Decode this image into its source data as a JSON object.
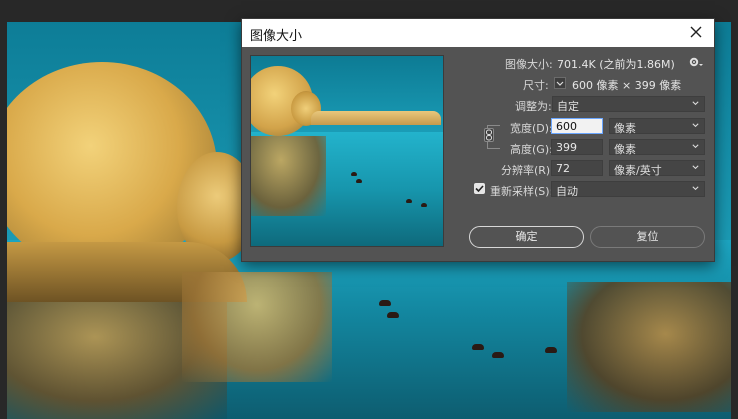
{
  "dialog": {
    "title": "图像大小",
    "image_size_label": "图像大小:",
    "image_size_value": "701.4K (之前为1.86M)",
    "dimensions_label": "尺寸:",
    "dimensions_value": "600 像素 × 399 像素",
    "fit_to_label": "调整为:",
    "fit_to_value": "自定",
    "width_label": "宽度(D):",
    "width_value": "600",
    "width_unit": "像素",
    "height_label": "高度(G):",
    "height_value": "399",
    "height_unit": "像素",
    "resolution_label": "分辨率(R):",
    "resolution_value": "72",
    "resolution_unit": "像素/英寸",
    "resample_label": "重新采样(S):",
    "resample_value": "自动",
    "resample_checked": true,
    "ok_label": "确定",
    "reset_label": "复位"
  },
  "icons": [
    "close-icon",
    "gear-icon",
    "chain-link-icon",
    "chevron-down-icon",
    "checkmark-icon"
  ],
  "colors": {
    "dialog_bg": "#535353",
    "titlebar_bg": "#ffffff",
    "field_bg": "#454545",
    "active_field_bg": "#f2f2f2",
    "focus_outline": "#6aa6ff"
  }
}
